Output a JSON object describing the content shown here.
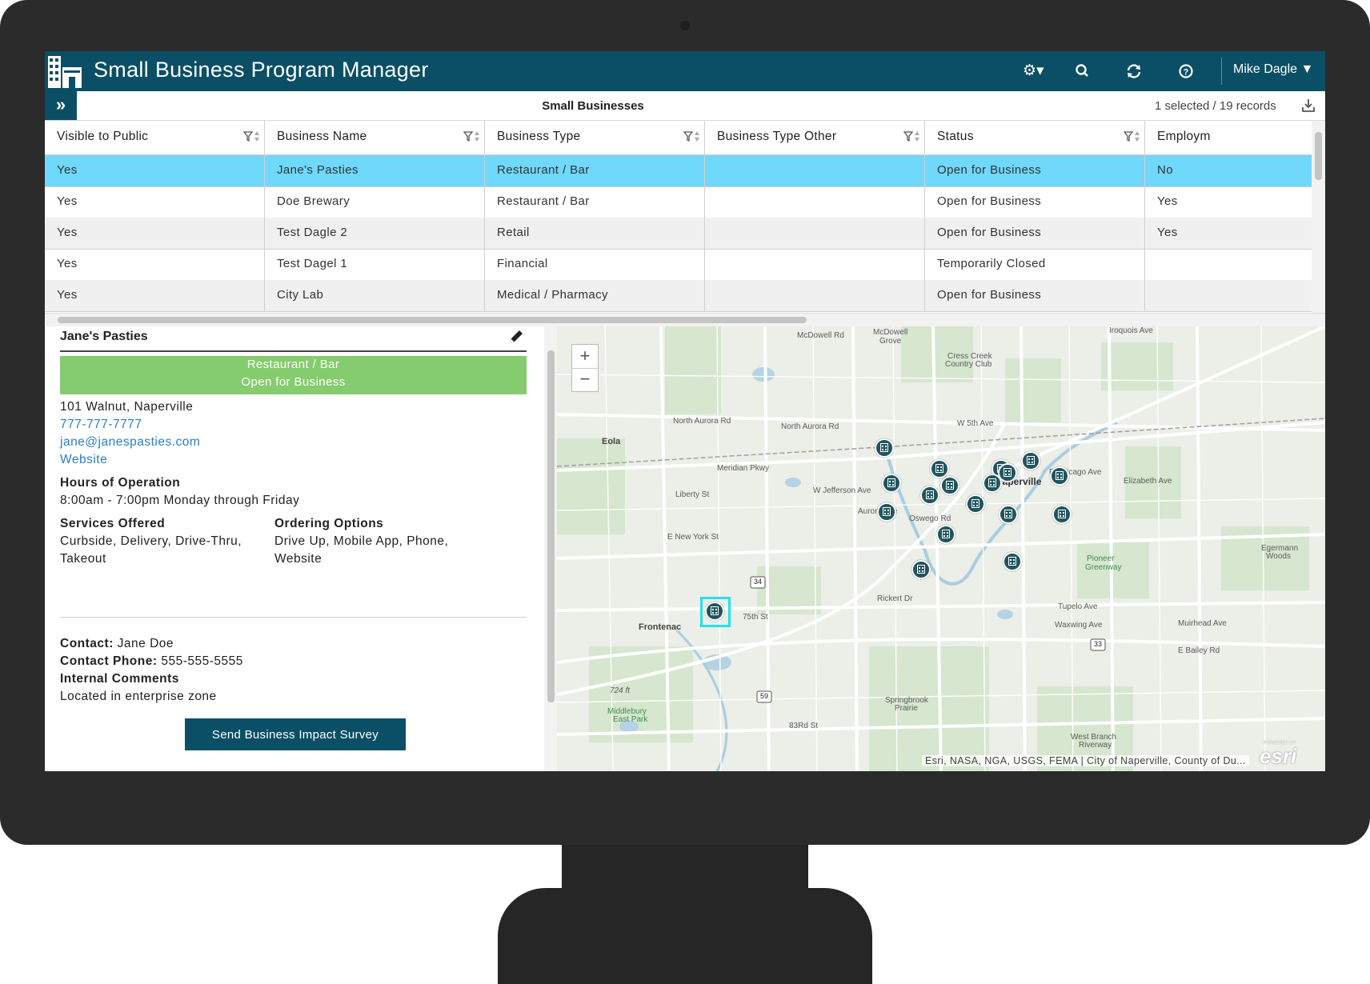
{
  "app": {
    "title": "Small Business Program Manager",
    "user": "Mike Dagle ▼"
  },
  "table": {
    "title": "Small Businesses",
    "count": "1 selected / 19 records",
    "columns": [
      "Visible to Public",
      "Business Name",
      "Business Type",
      "Business Type Other",
      "Status",
      "Employm"
    ],
    "rows": [
      [
        "Yes",
        "Jane's Pasties",
        "Restaurant / Bar",
        "",
        "Open for Business",
        "No"
      ],
      [
        "Yes",
        "Doe Brewary",
        "Restaurant / Bar",
        "",
        "Open for Business",
        "Yes"
      ],
      [
        "Yes",
        "Test Dagle 2",
        "Retail",
        "",
        "Open for Business",
        "Yes"
      ],
      [
        "Yes",
        "Test Dagel 1",
        "Financial",
        "",
        "Temporarily Closed",
        ""
      ],
      [
        "Yes",
        "City Lab",
        "Medical / Pharmacy",
        "",
        "Open for Business",
        ""
      ]
    ],
    "selected_row": 0
  },
  "detail": {
    "name": "Jane's Pasties",
    "type": "Restaurant / Bar",
    "status": "Open for Business",
    "address": "101 Walnut, Naperville",
    "phone": "777-777-7777",
    "email": "jane@janespasties.com",
    "website": "Website",
    "hours_label": "Hours of Operation",
    "hours": "8:00am - 7:00pm Monday through Friday",
    "services_label": "Services Offered",
    "services_1": "Curbside, Delivery, Drive-Thru,",
    "services_2": "Takeout",
    "ordering_label": "Ordering Options",
    "ordering_1": "Drive Up, Mobile App, Phone,",
    "ordering_2": "Website",
    "contact_label": "Contact:",
    "contact": "Jane Doe",
    "contact_phone_label": "Contact Phone:",
    "contact_phone": "555-555-5555",
    "comments_label": "Internal Comments",
    "comments": "Located in enterprise zone",
    "survey_button": "Send Business Impact Survey"
  },
  "map": {
    "zoom_in": "+",
    "zoom_out": "−",
    "attribution": "Esri, NASA, NGA, USGS, FEMA | City of Naperville, County of Du...",
    "logo": "esri",
    "logo_sub": "POWERED BY",
    "labels": [
      {
        "text": "McDowell Rd"
      },
      {
        "text": "McDowell"
      },
      {
        "text": "Grove"
      },
      {
        "text": "Cress Creek"
      },
      {
        "text": "Country Club"
      },
      {
        "text": "Iroquois Ave"
      },
      {
        "text": "North Aurora Rd"
      },
      {
        "text": "W 5th Ave"
      },
      {
        "text": "Eola"
      },
      {
        "text": "Meridian Pkwy"
      },
      {
        "text": "W Jefferson Ave"
      },
      {
        "text": "Liberty St"
      },
      {
        "text": "Naperville"
      },
      {
        "text": "E Chicago Ave"
      },
      {
        "text": "Elizabeth Ave"
      },
      {
        "text": "E New York St"
      },
      {
        "text": "Oswego Rd"
      },
      {
        "text": "Pioneer"
      },
      {
        "text": "Greenway"
      },
      {
        "text": "Egermann"
      },
      {
        "text": "Woods"
      },
      {
        "text": "Rickert Dr"
      },
      {
        "text": "Tupelo Ave"
      },
      {
        "text": "Waxwing Ave"
      },
      {
        "text": "Frontenac"
      },
      {
        "text": "75th St"
      },
      {
        "text": "Muirhead Ave"
      },
      {
        "text": "E Bailey Rd"
      },
      {
        "text": "Springbrook"
      },
      {
        "text": "Prairie"
      },
      {
        "text": "Middlebury"
      },
      {
        "text": "East Park"
      },
      {
        "text": "83Rd St"
      },
      {
        "text": "West Branch"
      },
      {
        "text": "Riverway"
      },
      {
        "text": "724 ft"
      },
      {
        "text": "North Aurora Rd"
      },
      {
        "text": "Aurora Ave"
      }
    ],
    "shields": [
      "34",
      "59",
      "33"
    ]
  },
  "colors": {
    "header": "#0a4f66",
    "selected_row": "#6fd8fb",
    "badge": "#85cc6e",
    "link": "#2a7ec8",
    "highlight": "#26e0ee"
  }
}
